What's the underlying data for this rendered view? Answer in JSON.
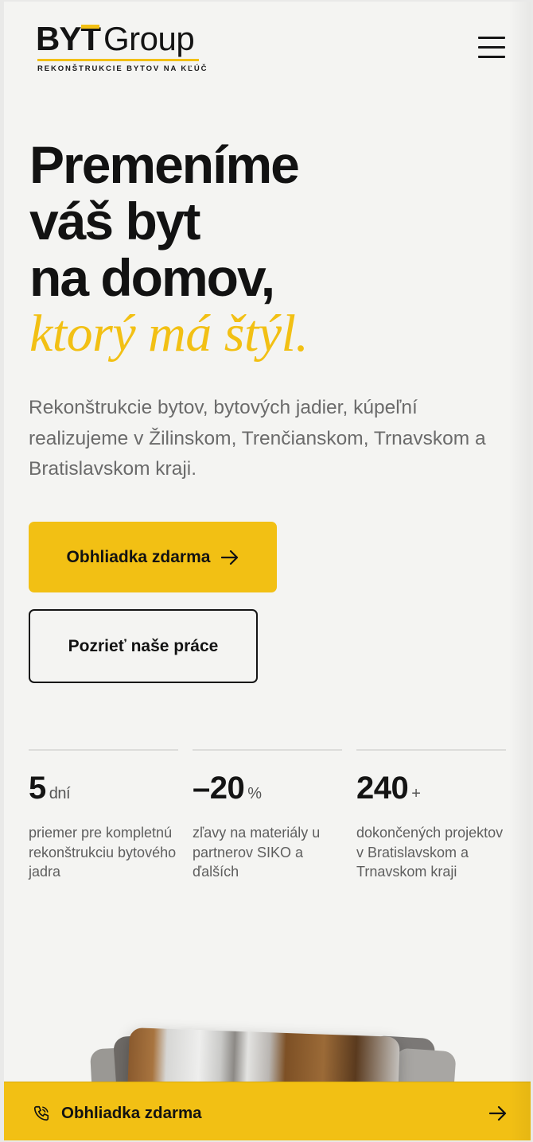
{
  "header": {
    "logo": {
      "byt": "BY",
      "t": "T",
      "group": "Group",
      "tagline": "REKONŠTRUKCIE BYTOV NA KĽÚČ"
    },
    "menu_icon": "hamburger-menu-icon"
  },
  "hero": {
    "title_lines": [
      "Premeníme",
      "váš byt",
      "na domov,"
    ],
    "title_accent": "ktorý má štýl.",
    "lead": "Rekonštrukcie bytov, bytových jadier, kúpeľní realizujeme v Žilinskom, Trenčianskom, Trnavskom a Bratislavskom kraji.",
    "primary_button": "Obhliadka zdarma",
    "secondary_button": "Pozrieť naše práce"
  },
  "stats": [
    {
      "value": "5",
      "unit": "dní",
      "desc": "priemer pre kompletnú rekonštrukciu bytového jadra"
    },
    {
      "value": "–20",
      "unit": "%",
      "desc": "zľavy na materiály u partnerov SIKO a ďalších"
    },
    {
      "value": "240",
      "unit": "+",
      "desc": "dokončených projektov v Bratislavskom a Trnavskom kraji"
    }
  ],
  "sticky_cta": {
    "label": "Obhliadka zdarma",
    "icon": "phone-icon",
    "arrow_icon": "arrow-right-icon"
  },
  "colors": {
    "accent": "#f2c014",
    "text": "#121212",
    "muted": "#6b6b6b",
    "background": "#f4f4f2"
  }
}
